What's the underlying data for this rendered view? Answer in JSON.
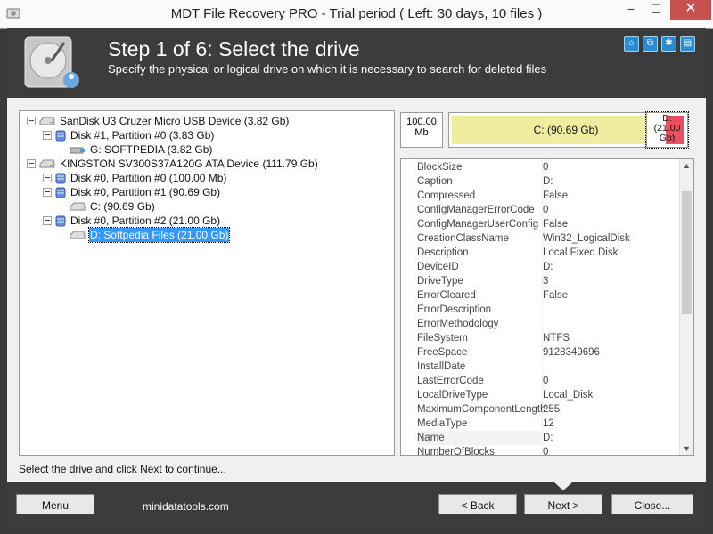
{
  "window": {
    "title": "MDT File Recovery PRO - Trial period ( Left: 30 days, 10 files )",
    "min_glyph": "−",
    "max_glyph": "☐",
    "close_glyph": "✕"
  },
  "header": {
    "step_title": "Step 1 of 6: Select the drive",
    "step_subtitle": "Specify the physical or logical drive on which it is necessary to search for deleted files",
    "icons": [
      "home-icon",
      "network-icon",
      "settings-icon",
      "info-icon"
    ],
    "icon_glyphs": [
      "⌂",
      "⧉",
      "✱",
      "▤"
    ]
  },
  "tree": [
    {
      "label": "SanDisk U3 Cruzer Micro USB Device (3.82 Gb)",
      "level": 0,
      "type": "device",
      "expanded": true
    },
    {
      "label": "Disk #1, Partition #0 (3.83 Gb)",
      "level": 1,
      "type": "partition",
      "expanded": true
    },
    {
      "label": "G: SOFTPEDIA (3.82 Gb)",
      "level": 2,
      "type": "usb-drive"
    },
    {
      "label": "KINGSTON SV300S37A120G ATA Device (111.79 Gb)",
      "level": 0,
      "type": "device",
      "expanded": true
    },
    {
      "label": "Disk #0, Partition #0 (100.00 Mb)",
      "level": 1,
      "type": "partition"
    },
    {
      "label": "Disk #0, Partition #1 (90.69 Gb)",
      "level": 1,
      "type": "partition",
      "expanded": true
    },
    {
      "label": "C:  (90.69 Gb)",
      "level": 2,
      "type": "logical-drive"
    },
    {
      "label": "Disk #0, Partition #2 (21.00 Gb)",
      "level": 1,
      "type": "partition",
      "expanded": true
    },
    {
      "label": "D: Softpedia Files (21.00 Gb)",
      "level": 2,
      "type": "logical-drive",
      "selected": true
    }
  ],
  "gauge": {
    "small_label": "100.00 Mb",
    "main_label": "C: (90.69 Gb)",
    "right_label": "D: (21.00 Gb)",
    "fill_color": "#f0eca0",
    "right_fill_color": "#e85060",
    "main_fill_fraction": 0.88,
    "right_fill_fraction": 0.55
  },
  "properties": [
    {
      "name": "BlockSize",
      "value": "0"
    },
    {
      "name": "Caption",
      "value": "D:"
    },
    {
      "name": "Compressed",
      "value": "False"
    },
    {
      "name": "ConfigManagerErrorCode",
      "value": "0"
    },
    {
      "name": "ConfigManagerUserConfig",
      "value": "False"
    },
    {
      "name": "CreationClassName",
      "value": "Win32_LogicalDisk"
    },
    {
      "name": "Description",
      "value": "Local Fixed Disk"
    },
    {
      "name": "DeviceID",
      "value": "D:"
    },
    {
      "name": "DriveType",
      "value": "3"
    },
    {
      "name": "ErrorCleared",
      "value": "False"
    },
    {
      "name": "ErrorDescription",
      "value": ""
    },
    {
      "name": "ErrorMethodology",
      "value": ""
    },
    {
      "name": "FileSystem",
      "value": "NTFS"
    },
    {
      "name": "FreeSpace",
      "value": "9128349696"
    },
    {
      "name": "InstallDate",
      "value": ""
    },
    {
      "name": "LastErrorCode",
      "value": "0"
    },
    {
      "name": "LocalDriveType",
      "value": "Local_Disk"
    },
    {
      "name": "MaximumComponentLength",
      "value": "255"
    },
    {
      "name": "MediaType",
      "value": "12"
    },
    {
      "name": "Name",
      "value": "D:",
      "highlight": true
    },
    {
      "name": "NumberOfBlocks",
      "value": "0"
    }
  ],
  "status": "Select the drive and click Next to continue...",
  "footer": {
    "menu_label": "Menu",
    "website": "minidatatools.com",
    "back_label": "< Back",
    "next_label": "Next >",
    "close_label": "Close..."
  },
  "colors": {
    "selection": "#3399ff",
    "accent_icon": "#2a8dd4",
    "header_bg": "#3c3c3c"
  }
}
